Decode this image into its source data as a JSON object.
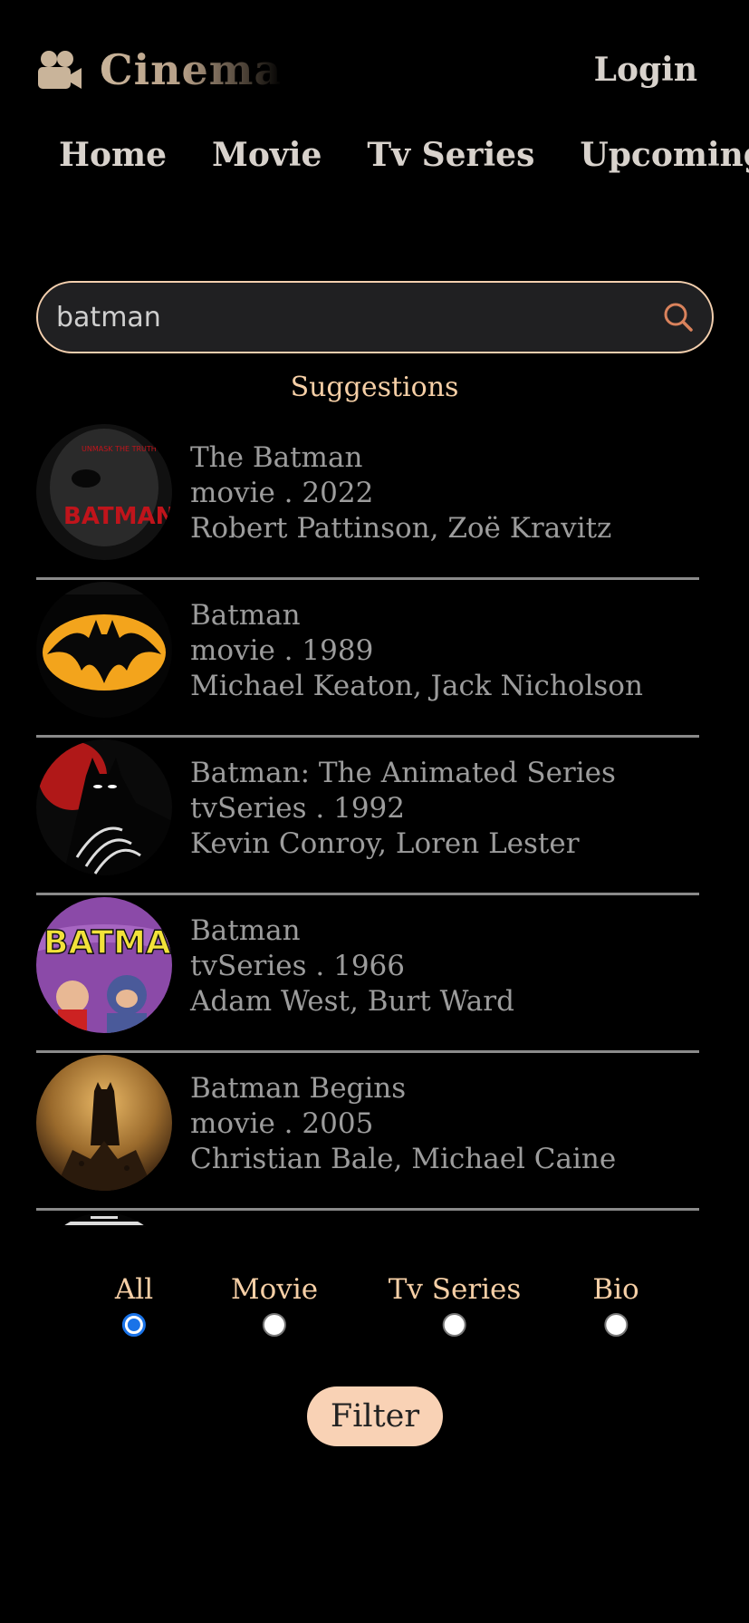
{
  "header": {
    "brand": "Cinema",
    "login": "Login"
  },
  "nav": [
    "Home",
    "Movie",
    "Tv Series",
    "Upcoming"
  ],
  "search": {
    "value": "batman"
  },
  "suggestions": {
    "title": "Suggestions",
    "items": [
      {
        "title": "The Batman",
        "meta": "movie . 2022",
        "cast": "Robert Pattinson, Zoë Kravitz"
      },
      {
        "title": "Batman",
        "meta": "movie . 1989",
        "cast": "Michael Keaton, Jack Nicholson"
      },
      {
        "title": "Batman: The Animated Series",
        "meta": "tvSeries . 1992",
        "cast": "Kevin Conroy, Loren Lester"
      },
      {
        "title": "Batman",
        "meta": "tvSeries . 1966",
        "cast": "Adam West, Burt Ward"
      },
      {
        "title": "Batman Begins",
        "meta": "movie . 2005",
        "cast": "Christian Bale, Michael Caine"
      }
    ]
  },
  "filters": {
    "options": [
      "All",
      "Movie",
      "Tv Series",
      "Bio"
    ],
    "selected": "All",
    "button": "Filter"
  },
  "colors": {
    "accent": "#f6cfa6",
    "button": "#f9d2b5",
    "radio": "#1a73e8"
  }
}
